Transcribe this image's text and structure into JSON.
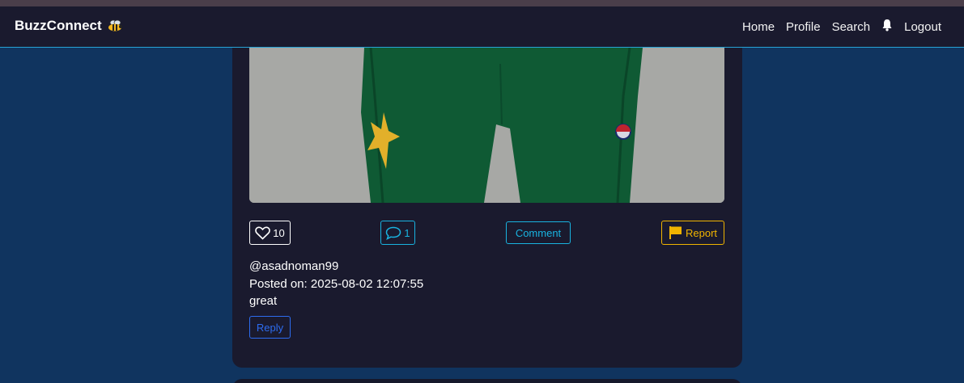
{
  "navbar": {
    "brand": "BuzzConnect",
    "links": [
      "Home",
      "Profile",
      "Search",
      "Logout"
    ]
  },
  "post": {
    "likes_count": "10",
    "comments_count": "1",
    "comment_label": "Comment",
    "report_label": "Report",
    "username": "@asadnoman99",
    "posted_on": "Posted on: 2025-08-02 12:07:55",
    "text": "great",
    "reply_label": "Reply"
  },
  "colors": {
    "page_bg": "#10345f",
    "card_bg": "#1a1a2e",
    "accent_cyan": "#19b3e0",
    "report_yellow": "#f0b400",
    "reply_blue": "#2d6cf0",
    "jersey_green": "#0f5a34"
  }
}
